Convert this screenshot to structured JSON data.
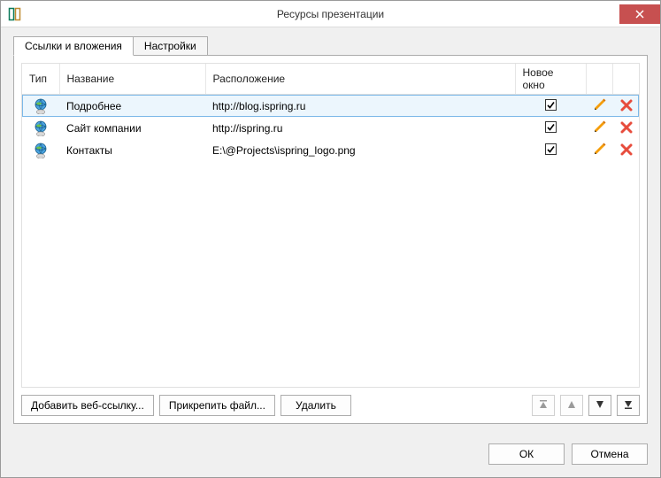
{
  "window": {
    "title": "Ресурсы презентации"
  },
  "tabs": {
    "links": "Ссылки и вложения",
    "settings": "Настройки"
  },
  "columns": {
    "type": "Тип",
    "name": "Название",
    "location": "Расположение",
    "new_window": "Новое окно"
  },
  "rows": [
    {
      "name": "Подробнее",
      "location": "http://blog.ispring.ru",
      "new_window": true,
      "selected": true
    },
    {
      "name": "Сайт компании",
      "location": "http://ispring.ru",
      "new_window": true,
      "selected": false
    },
    {
      "name": "Контакты",
      "location": "E:\\@Projects\\ispring_logo.png",
      "new_window": true,
      "selected": false
    }
  ],
  "buttons": {
    "add_link": "Добавить веб-ссылку...",
    "attach_file": "Прикрепить файл...",
    "delete": "Удалить",
    "ok": "ОК",
    "cancel": "Отмена"
  }
}
